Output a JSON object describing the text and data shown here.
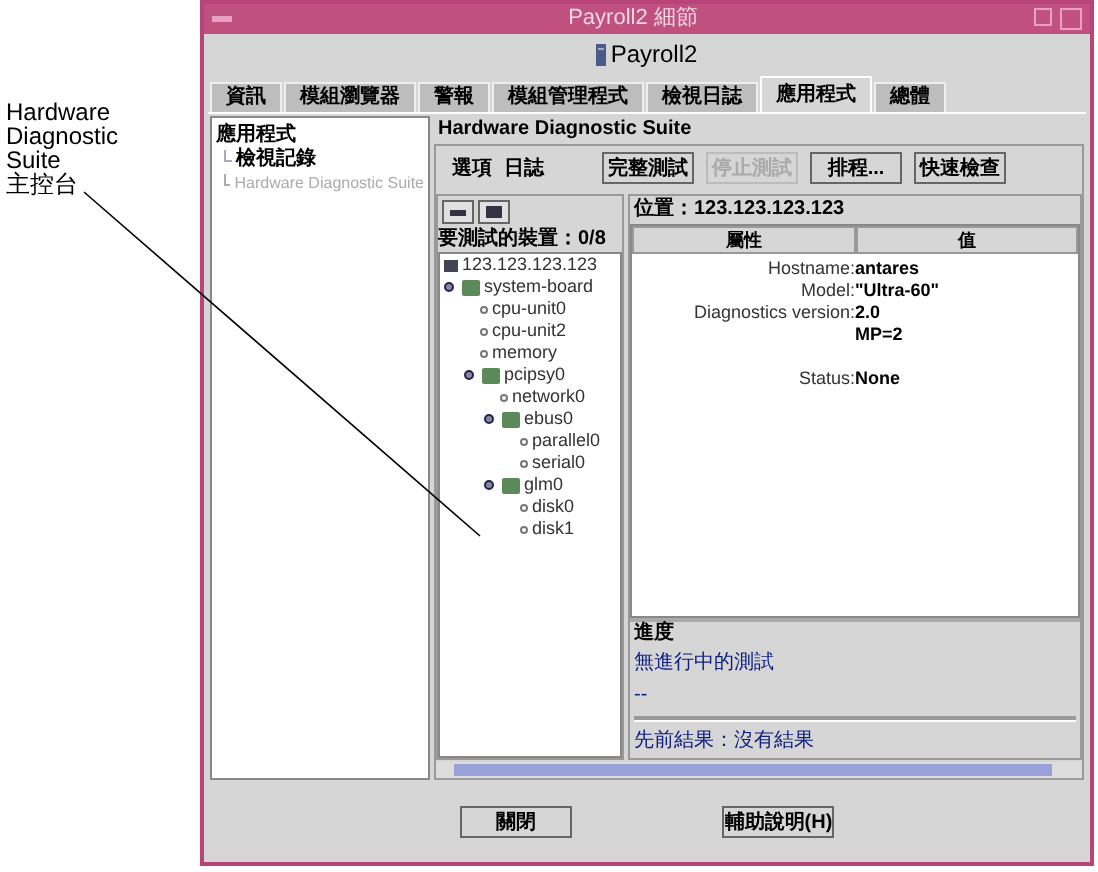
{
  "callout": {
    "lines": [
      "Hardware",
      "Diagnostic",
      "Suite",
      "主控台"
    ]
  },
  "window": {
    "title": "Payroll2 細節",
    "header": "Payroll2"
  },
  "tabs": [
    {
      "label": "資訊",
      "selected": false
    },
    {
      "label": "模組瀏覽器",
      "selected": false
    },
    {
      "label": "警報",
      "selected": false
    },
    {
      "label": "模組管理程式",
      "selected": false
    },
    {
      "label": "檢視日誌",
      "selected": false
    },
    {
      "label": "應用程式",
      "selected": true
    },
    {
      "label": "總體",
      "selected": false
    }
  ],
  "sidebar": {
    "title": "應用程式",
    "items": [
      {
        "label": "檢視記錄",
        "selected": false
      },
      {
        "label": "Hardware Diagnostic Suite",
        "selected": true
      }
    ]
  },
  "panel": {
    "title": "Hardware Diagnostic Suite",
    "menu": [
      "選項",
      "日誌"
    ],
    "buttons": [
      {
        "label": "完整測試",
        "disabled": false
      },
      {
        "label": "停止測試",
        "disabled": true
      },
      {
        "label": "排程...",
        "disabled": false
      },
      {
        "label": "快速檢查",
        "disabled": false
      }
    ],
    "devices_label": "要測試的裝置：0/8",
    "tree": [
      {
        "kind": "host",
        "label": "123.123.123.123",
        "children": [
          {
            "kind": "group",
            "label": "system-board",
            "expanded": true,
            "children": [
              {
                "kind": "leaf",
                "label": "cpu-unit0"
              },
              {
                "kind": "leaf",
                "label": "cpu-unit2"
              },
              {
                "kind": "leaf",
                "label": "memory"
              },
              {
                "kind": "group",
                "label": "pcipsy0",
                "expanded": true,
                "children": [
                  {
                    "kind": "leaf",
                    "label": "network0"
                  },
                  {
                    "kind": "group",
                    "label": "ebus0",
                    "expanded": true,
                    "children": [
                      {
                        "kind": "leaf",
                        "label": "parallel0"
                      },
                      {
                        "kind": "leaf",
                        "label": "serial0"
                      }
                    ]
                  },
                  {
                    "kind": "group",
                    "label": "glm0",
                    "expanded": true,
                    "children": [
                      {
                        "kind": "leaf",
                        "label": "disk0"
                      },
                      {
                        "kind": "leaf",
                        "label": "disk1"
                      }
                    ]
                  }
                ]
              }
            ]
          }
        ]
      }
    ],
    "location": "位置：123.123.123.123",
    "table": {
      "columns": [
        "屬性",
        "值"
      ],
      "rows": [
        {
          "name": "Hostname:",
          "value": "antares"
        },
        {
          "name": "Model:",
          "value": "\"Ultra-60\""
        },
        {
          "name": "Diagnostics version:",
          "value": "2.0"
        },
        {
          "value": "MP=2"
        },
        {},
        {
          "name": "Status:",
          "value": "None"
        }
      ]
    },
    "progress": {
      "title": "進度",
      "status": "無進行中的測試",
      "detail": "--",
      "previous": "先前結果：沒有結果"
    }
  },
  "buttons": [
    "關閉",
    "輔助說明(H)"
  ]
}
